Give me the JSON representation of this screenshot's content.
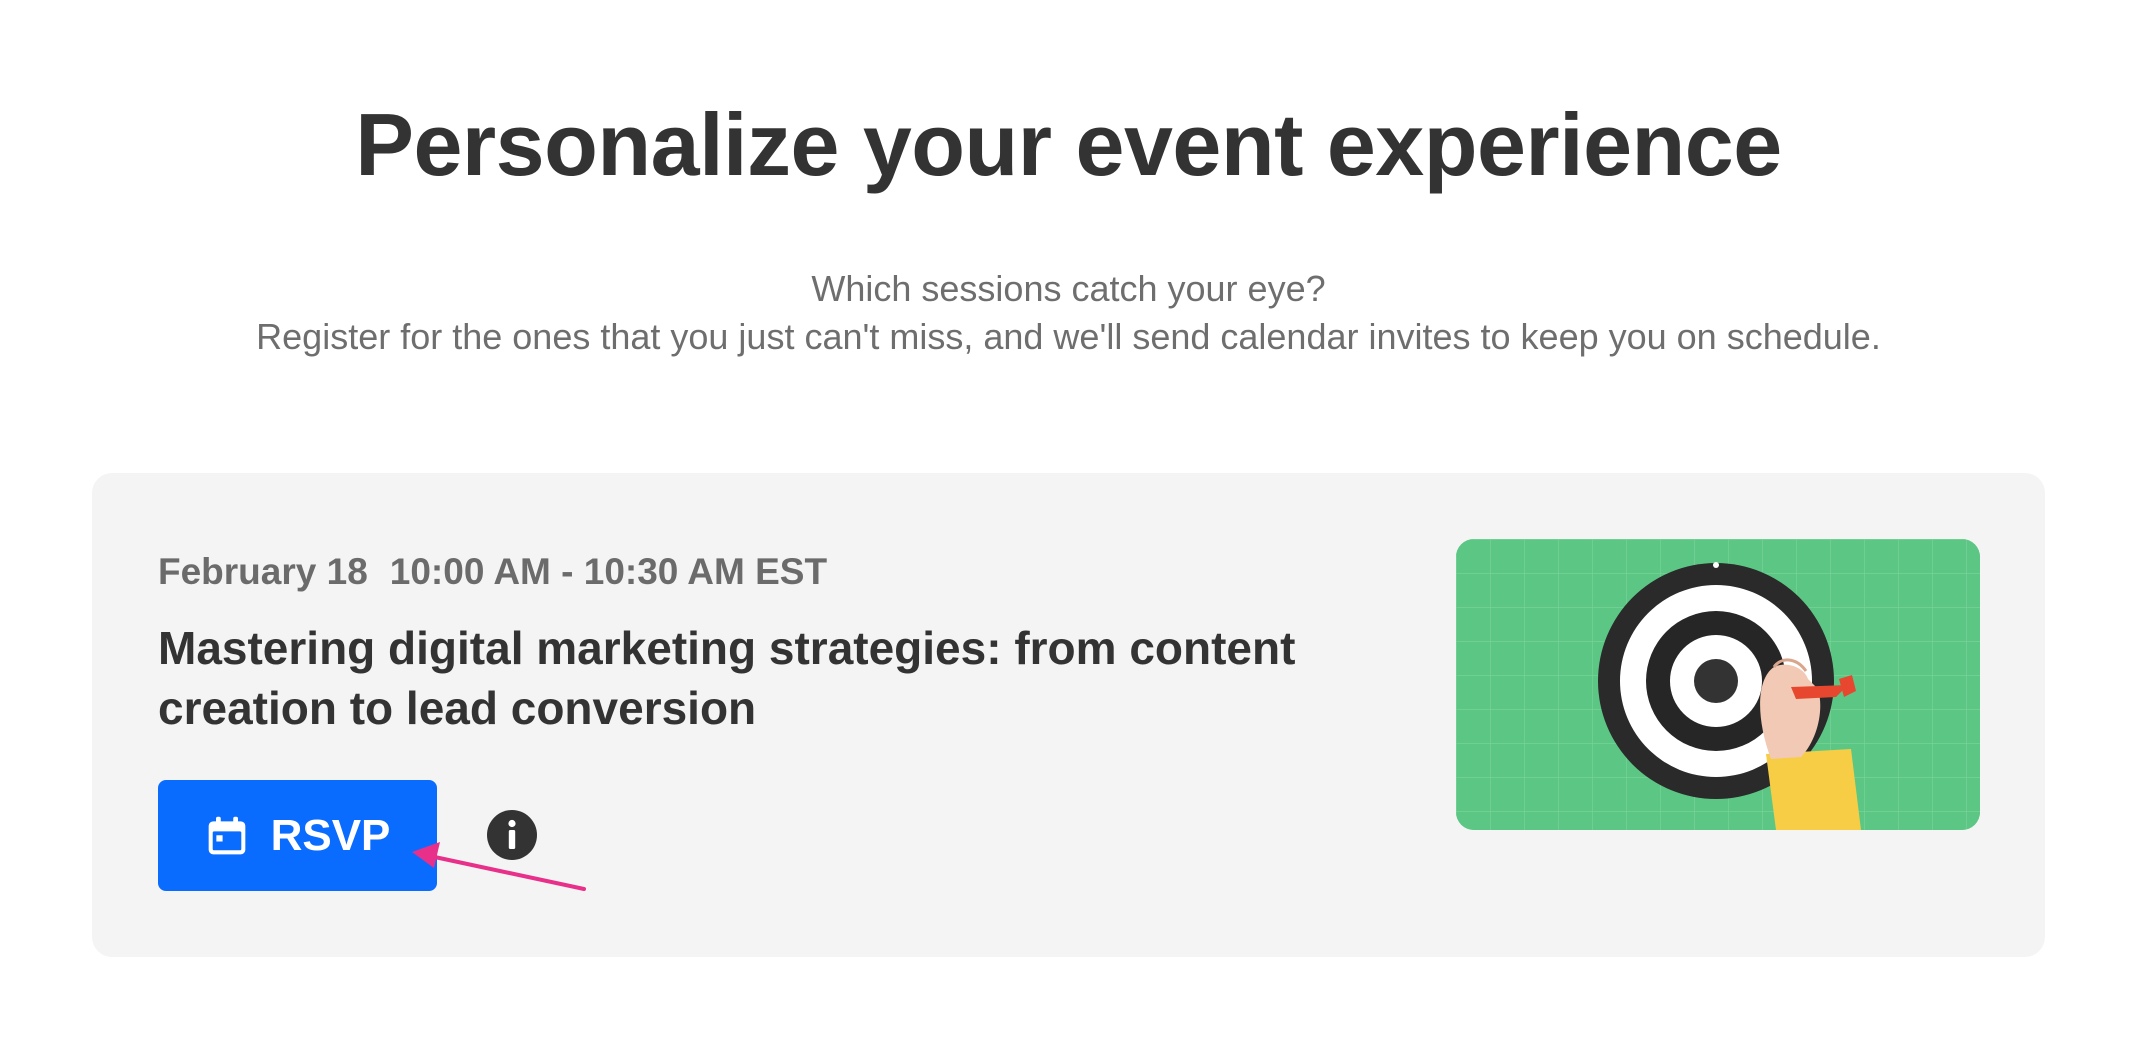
{
  "page": {
    "title": "Personalize your event experience",
    "subtitle_line1": "Which sessions catch your eye?",
    "subtitle_line2": "Register for the ones that you just can't miss, and we'll send calendar invites to keep you on schedule."
  },
  "session": {
    "date": "February 18",
    "time": "10:00 AM - 10:30 AM EST",
    "title": "Mastering digital marketing strategies: from content creation to lead conversion",
    "rsvp_label": "RSVP",
    "rsvp_icon": "calendar-icon",
    "info_icon": "info-icon",
    "image_subject": "dartboard-with-hand-holding-dart"
  },
  "colors": {
    "title": "#333333",
    "subtitle": "#6e6e6e",
    "card_background": "#f4f4f4",
    "rsvp_button": "#0a6cff",
    "image_background": "#5cc784",
    "annotation_arrow": "#e8308a"
  }
}
